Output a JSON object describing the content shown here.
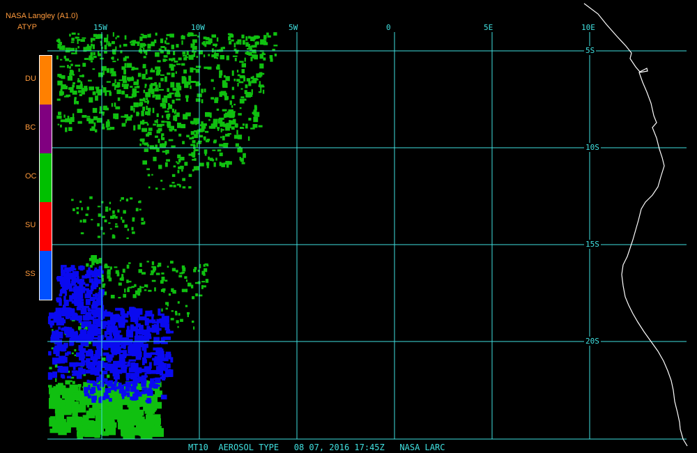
{
  "header": {
    "line1": "NASA Langley (A1.0)",
    "line2": "ATYP"
  },
  "legend": {
    "items": [
      {
        "label": "DU",
        "color": "#ff8000"
      },
      {
        "label": "BC",
        "color": "#800080"
      },
      {
        "label": "OC",
        "color": "#00c000"
      },
      {
        "label": "SU",
        "color": "#ff0000"
      },
      {
        "label": "SS",
        "color": "#0050ff"
      }
    ]
  },
  "grid": {
    "longitudes": [
      {
        "label": "15W",
        "value": -15
      },
      {
        "label": "10W",
        "value": -10
      },
      {
        "label": "5W",
        "value": -5
      },
      {
        "label": "0",
        "value": 0
      },
      {
        "label": "5E",
        "value": 5
      },
      {
        "label": "10E",
        "value": 10
      }
    ],
    "latitudes": [
      {
        "label": "5S",
        "value": -5
      },
      {
        "label": "10S",
        "value": -10
      },
      {
        "label": "15S",
        "value": -15
      },
      {
        "label": "20S",
        "value": -20
      }
    ]
  },
  "footer": "MT10  AEROSOL TYPE   08 07, 2016 17:45Z   NASA LARC",
  "colors": {
    "grid": "#40e0e0",
    "header": "#ff9a3c",
    "coastline": "#ffffff",
    "oc_pixels": "#10c010",
    "ss_pixels": "#0a0af0",
    "background": "#000000"
  }
}
